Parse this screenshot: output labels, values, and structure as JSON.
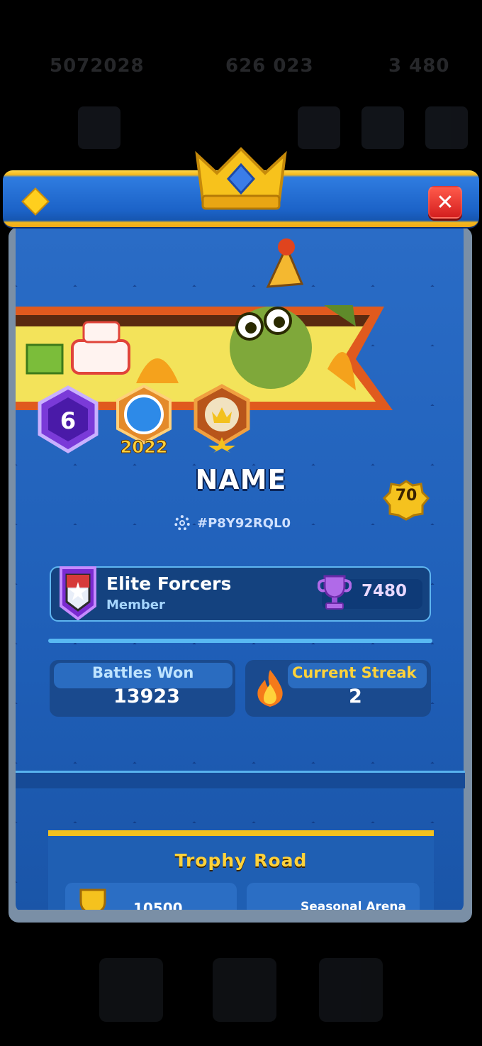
{
  "background": {
    "resource_1": "5072028",
    "resource_2": "626 023",
    "resource_3": "3 480"
  },
  "profile": {
    "name": "NAME",
    "tag": "#P8Y92RQL0",
    "level": "70",
    "badges": [
      {
        "name": "arena-badge",
        "label": "6"
      },
      {
        "name": "year-badge",
        "label": "2022"
      },
      {
        "name": "crown-badge",
        "label": ""
      }
    ]
  },
  "clan": {
    "name": "Elite Forcers",
    "role": "Member",
    "trophies": "7480"
  },
  "stats": {
    "battles_won_label": "Battles Won",
    "battles_won_value": "13923",
    "streak_label": "Current Streak",
    "streak_value": "2"
  },
  "section": {
    "title": "Trophy Road",
    "left_value": "10500",
    "right_label": "Seasonal Arena"
  },
  "icons": {
    "close": "close-icon",
    "crown": "crown-icon",
    "gem": "gem-icon",
    "gear": "gear-icon",
    "trophy": "trophy-icon",
    "flame": "flame-icon"
  },
  "colors": {
    "panel_blue": "#1f5fb8",
    "gold": "#f3c11d",
    "close_red": "#e0332a"
  }
}
